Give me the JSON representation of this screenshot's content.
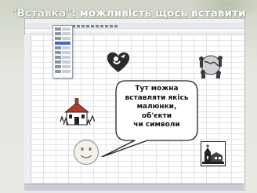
{
  "slide": {
    "title_highlight": "\"Вставка\"",
    "title_rest": ": можливість щось вставити"
  },
  "callout": {
    "lines": [
      "Тут можна",
      "вставляти якісь",
      "малюнки,",
      "об'єкти",
      "чи символи"
    ]
  },
  "icons": {
    "heart": "cupid-heart-icon",
    "world": "globe-people-icon",
    "school": "school-house-icon",
    "smiley": "smiley-face-icon",
    "church": "church-icon"
  },
  "colors": {
    "title": "#ffffff",
    "heart": "#2b2b2b",
    "smiley_fill": "#f4f1ea"
  }
}
